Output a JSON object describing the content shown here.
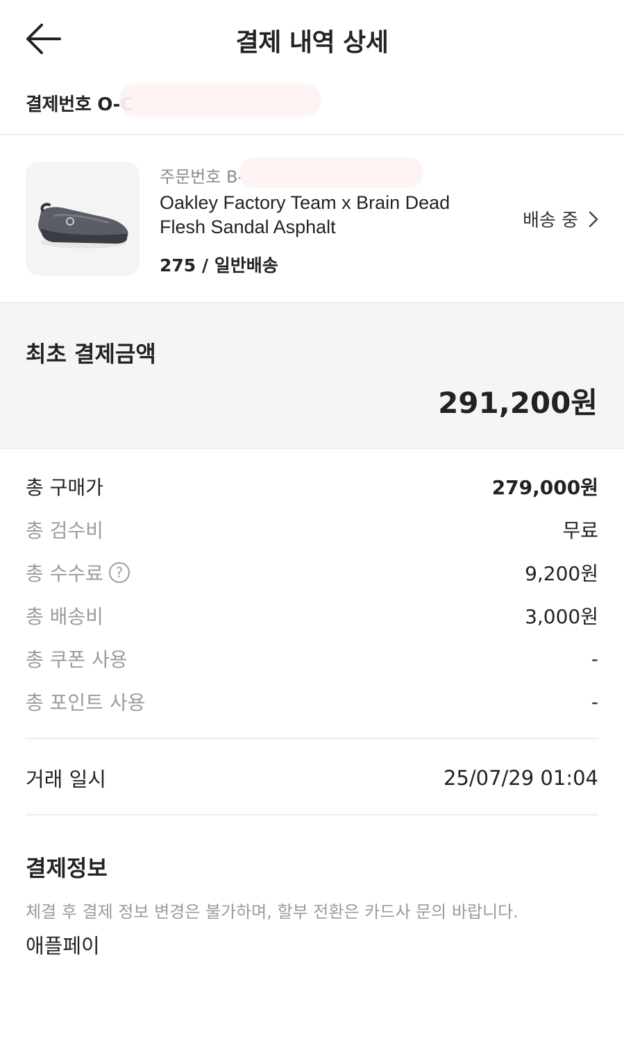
{
  "header": {
    "title": "결제 내역 상세"
  },
  "payment": {
    "number_text": "결제번호 O-C"
  },
  "product": {
    "order_no_text": "주문번호 B-C",
    "name": "Oakley Factory Team x Brain Dead Flesh Sandal Asphalt",
    "option": "275 / 일반배송",
    "status": "배송 중"
  },
  "summary": {
    "title": "최초 결제금액",
    "amount": "291,200원"
  },
  "breakdown": [
    {
      "label": "총 구매가",
      "value": "279,000원"
    },
    {
      "label": "총 검수비",
      "value": "무료"
    },
    {
      "label": "총 수수료",
      "value": "9,200원"
    },
    {
      "label": "총 배송비",
      "value": "3,000원"
    },
    {
      "label": "총 쿠폰 사용",
      "value": "-"
    },
    {
      "label": "총 포인트 사용",
      "value": "-"
    }
  ],
  "trade": {
    "label": "거래 일시",
    "value": "25/07/29 01:04"
  },
  "pay_info": {
    "title": "결제정보",
    "notice": "체결 후 결제 정보 변경은 불가하며, 할부 전환은 카드사 문의 바랍니다.",
    "method": "애플페이"
  },
  "icons": {
    "back": "arrow-left-icon",
    "status": "chevron-right-icon",
    "help": "question-circle-icon"
  }
}
